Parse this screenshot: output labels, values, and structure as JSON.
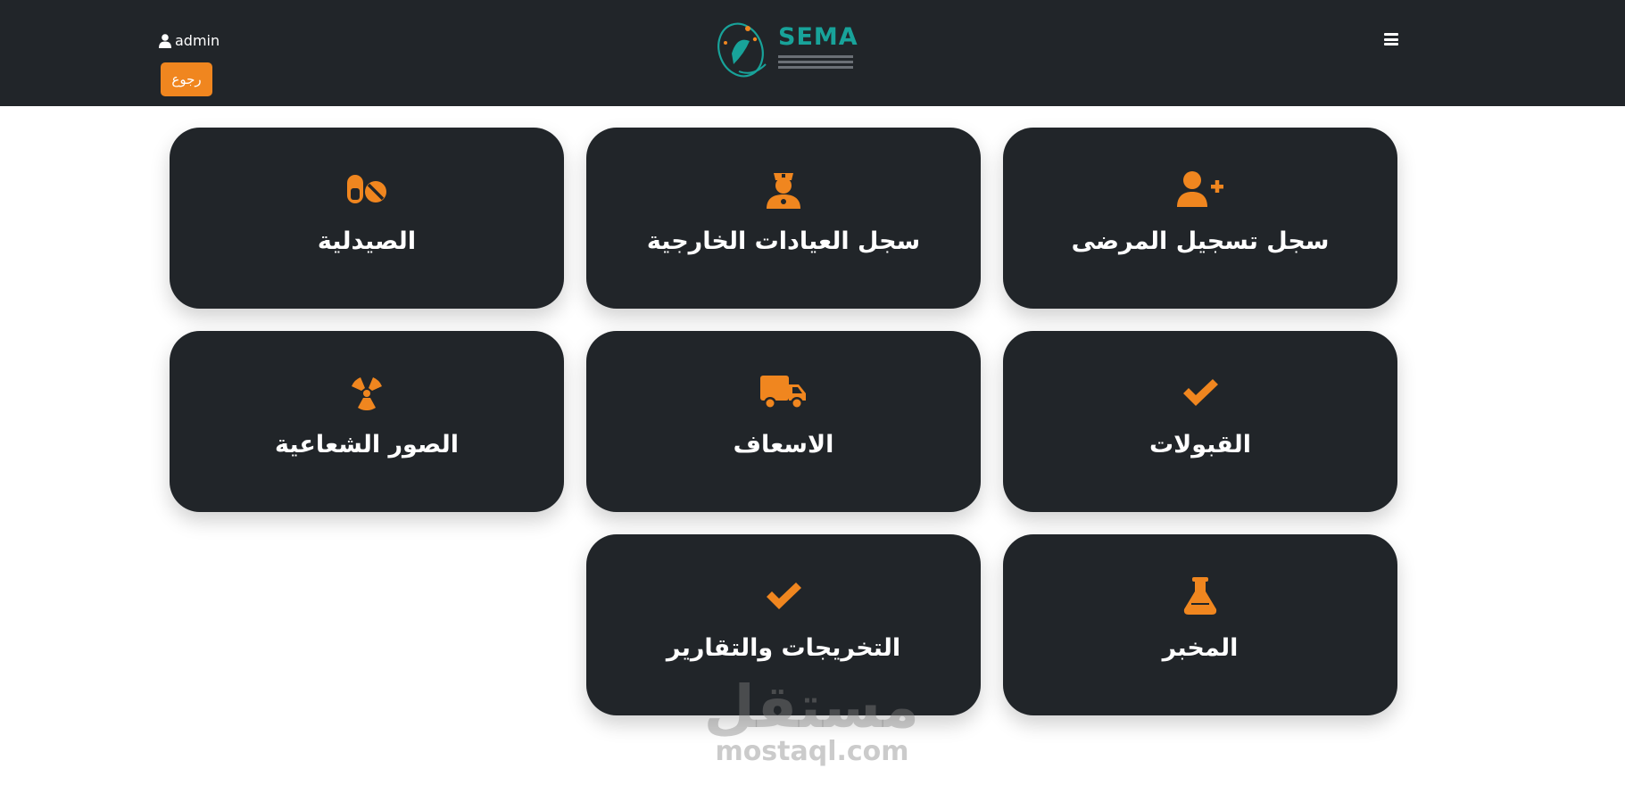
{
  "header": {
    "username": "admin",
    "back_label": "رجوع",
    "brand": "SEMA"
  },
  "cards": [
    {
      "label": "الصيدلية",
      "icon": "pills-icon"
    },
    {
      "label": "سجل العيادات الخارجية",
      "icon": "user-nurse-icon"
    },
    {
      "label": "سجل تسجيل المرضى",
      "icon": "user-plus-icon"
    },
    {
      "label": "الصور الشعاعية",
      "icon": "radiation-icon"
    },
    {
      "label": "الاسعاف",
      "icon": "ambulance-truck-icon"
    },
    {
      "label": "القبولات",
      "icon": "check-icon"
    },
    {
      "label": "التخريجات والتقارير",
      "icon": "check-icon"
    },
    {
      "label": "المخبر",
      "icon": "flask-icon"
    }
  ],
  "watermark": {
    "arabic": "مستقل",
    "latin": "mostaql.com"
  },
  "colors": {
    "header_bg": "#212529",
    "card_bg": "#212529",
    "accent": "#f0861f",
    "brand_teal": "#18a39a"
  }
}
